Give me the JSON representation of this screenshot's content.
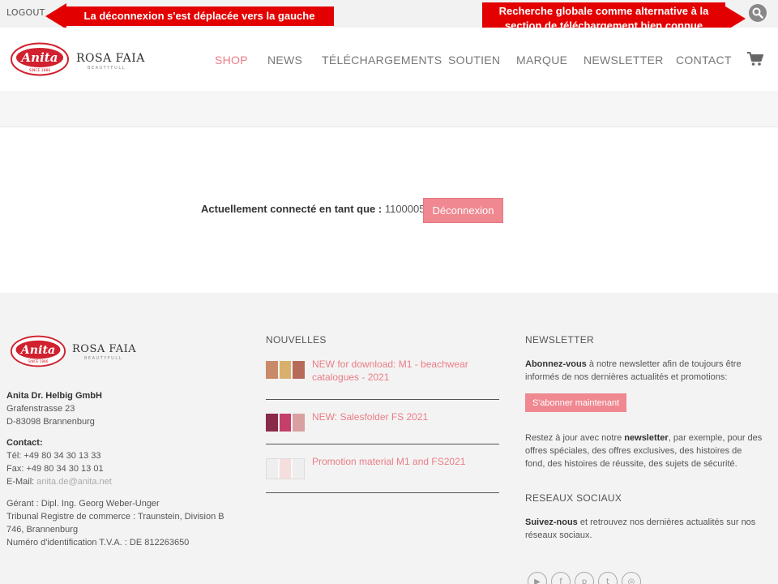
{
  "topbar": {
    "logout_label": "LOGOUT"
  },
  "annotations": {
    "left": "La déconnexion s'est déplacée vers la gauche",
    "right_line1": "Recherche globale comme alternative à la",
    "right_line2": "section de téléchargement bien connue"
  },
  "brand": {
    "anita": "Anita",
    "anita_since": "SINCE 1886",
    "rosa": "ROSA FAIA",
    "rosa_sub": "BEAUTYFULL"
  },
  "nav": {
    "items": [
      {
        "label": "SHOP",
        "active": true
      },
      {
        "label": "NEWS"
      },
      {
        "label": "TÉLÉCHARGEMENTS"
      },
      {
        "label": "SOUTIEN"
      },
      {
        "label": "MARQUE"
      },
      {
        "label": "NEWSLETTER"
      },
      {
        "label": "CONTACT"
      }
    ],
    "icons": {
      "search": "search-icon",
      "cart": "cart-icon"
    }
  },
  "main": {
    "logged_in_label": "Actuellement connecté en tant que :",
    "user_id": "11000053",
    "logout_button": "Déconnexion"
  },
  "footer": {
    "company": "Anita Dr. Helbig GmbH",
    "street": "Grafenstrasse 23",
    "city": "D-83098 Brannenburg",
    "contact_heading": "Contact:",
    "tel": "Tél: +49 80 34 30 13 33",
    "fax": "Fax: +49 80 34 30 13 01",
    "email_label": "E-Mail:",
    "email": "anita.de@anita.net",
    "manager": "Gérant : Dipl. Ing. Georg Weber-Unger",
    "register1": "Tribunal Registre de commerce : Traunstein, Division B",
    "register2": "746, Brannenburg",
    "vat": "Numéro d'identification T.V.A. : DE 812263650",
    "news_heading": "NOUVELLES",
    "news": [
      {
        "title": "NEW for download: M1 - beachwear catalogues - 2021"
      },
      {
        "title": "NEW: Salesfolder FS 2021"
      },
      {
        "title": "Promotion material M1 and FS2021"
      }
    ],
    "newsletter_heading": "NEWSLETTER",
    "newsletter_bold": "Abonnez-vous",
    "newsletter_text1": "à notre newsletter afin de toujours être",
    "newsletter_text2": "informés de nos dernières actualités et promotions:",
    "subscribe_button": "S'abonner maintenant",
    "stay1_pre": "Restez à jour avec notre",
    "stay1_bold": "newsletter",
    "stay1_post": ", par exemple, pour des",
    "stay2": "offres spéciales, des offres exclusives, des histoires de",
    "stay3": "fond, des histoires de réussite, des sujets de sécurité.",
    "social_heading": "RESEAUX SOCIAUX",
    "social_bold": "Suivez-nous",
    "social_text1": "et retrouvez nos dernières actualités sur nos",
    "social_text2": "réseaux sociaux.",
    "social_icons": [
      "youtube-icon",
      "facebook-icon",
      "pinterest-icon",
      "twitter-icon",
      "instagram-icon"
    ]
  },
  "colors": {
    "accent": "#ea7c86",
    "annotation": "#e30000",
    "button": "#ef8891"
  }
}
